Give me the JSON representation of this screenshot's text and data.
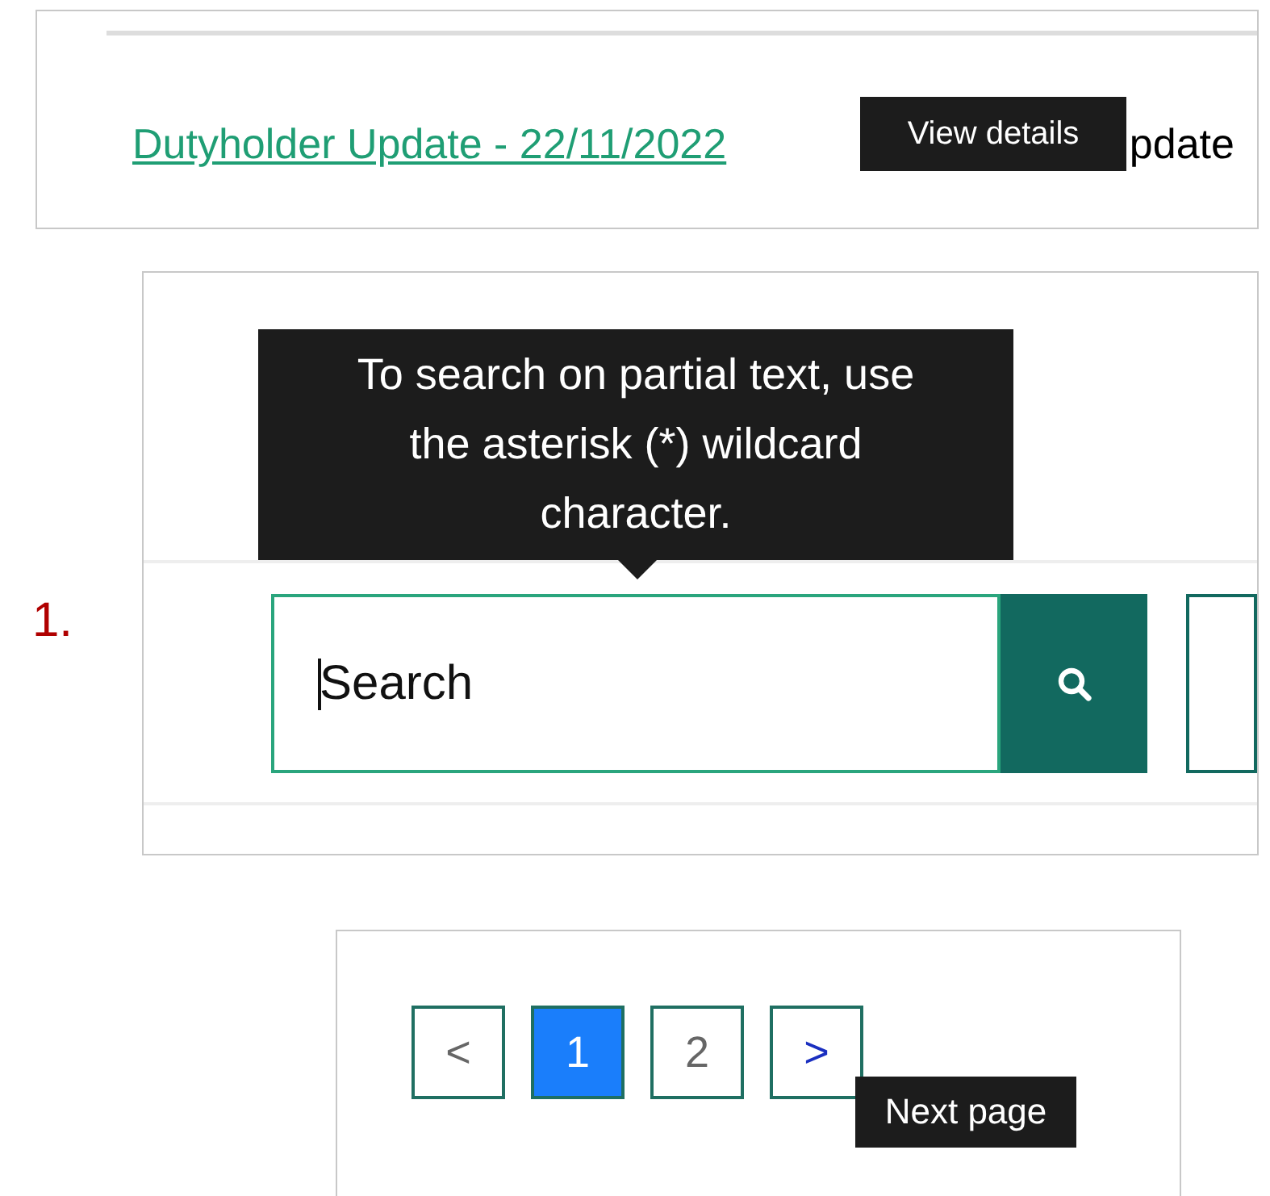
{
  "update_panel": {
    "link": "Dutyholder Update - 22/11/2022",
    "trailing_text": "pdate",
    "tooltip": "View details"
  },
  "search_panel": {
    "step_label": "1.",
    "tooltip": "To search on partial text, use the asterisk (*) wildcard character.",
    "search": {
      "placeholder": "Search"
    }
  },
  "pagination": {
    "items": [
      {
        "label": "<",
        "kind": "prev",
        "selected": false
      },
      {
        "label": "1",
        "kind": "page",
        "selected": true
      },
      {
        "label": "2",
        "kind": "page",
        "selected": false
      },
      {
        "label": ">",
        "kind": "next",
        "selected": false
      }
    ],
    "tooltip": "Next page"
  }
}
